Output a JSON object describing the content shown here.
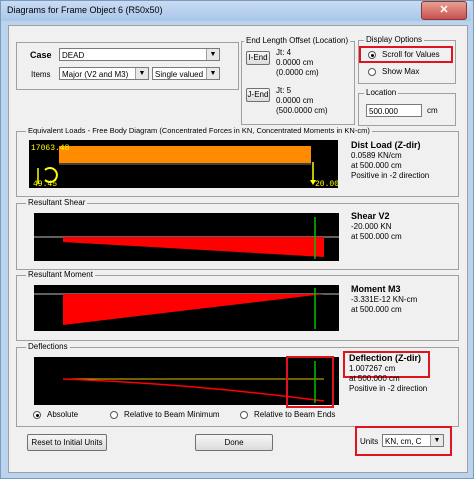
{
  "window": {
    "title": "Diagrams for Frame Object 6  (R50x50)"
  },
  "case": {
    "label": "Case",
    "value": "DEAD"
  },
  "items": {
    "label": "Items",
    "value": "Major (V2 and M3)",
    "mode": "Single valued"
  },
  "end_offset": {
    "title": "End Length Offset (Location)",
    "i_button": "I-End",
    "i_jt": "Jt:  4",
    "i_l1": "0.0000 cm",
    "i_l2": "(0.0000 cm)",
    "j_button": "J-End",
    "j_jt": "Jt:  5",
    "j_l1": "0.0000 cm",
    "j_l2": "(500.0000 cm)"
  },
  "display_options": {
    "title": "Display Options",
    "scroll": "Scroll for Values",
    "show_max": "Show Max",
    "selected": "scroll"
  },
  "location": {
    "title": "Location",
    "value": "500.000",
    "unit": "cm"
  },
  "equiv_loads": {
    "title": "Equivalent Loads - Free Body Diagram  (Concentrated Forces in KN, Concentrated Moments in KN-cm)",
    "left_top": "17063.48",
    "left_bottom": "49.45",
    "right_value": "20.00",
    "heading": "Dist Load (Z-dir)",
    "value": "0.0589 KN/cm",
    "at": "at 500.000 cm",
    "note": "Positive in -2 direction"
  },
  "shear": {
    "title": "Resultant Shear",
    "heading": "Shear V2",
    "value": "-20.000 KN",
    "at": "at 500.000 cm"
  },
  "moment": {
    "title": "Resultant Moment",
    "heading": "Moment M3",
    "value": "-3.331E-12 KN-cm",
    "at": "at 500.000 cm"
  },
  "deflection": {
    "title": "Deflections",
    "heading": "Deflection (Z-dir)",
    "value": "1.007267 cm",
    "at": "at 500.000 cm",
    "note": "Positive in -2 direction",
    "absolute": "Absolute",
    "rel_min": "Relative to Beam Minimum",
    "rel_ends": "Relative to Beam Ends",
    "selected": "absolute"
  },
  "footer": {
    "reset": "Reset to Initial Units",
    "done": "Done",
    "units_label": "Units",
    "units_value": "KN, cm, C"
  },
  "colors": {
    "accent_red": "#e0141e",
    "orange": "#ff8c00",
    "plot_red": "#ff0000",
    "green": "#00c000"
  }
}
